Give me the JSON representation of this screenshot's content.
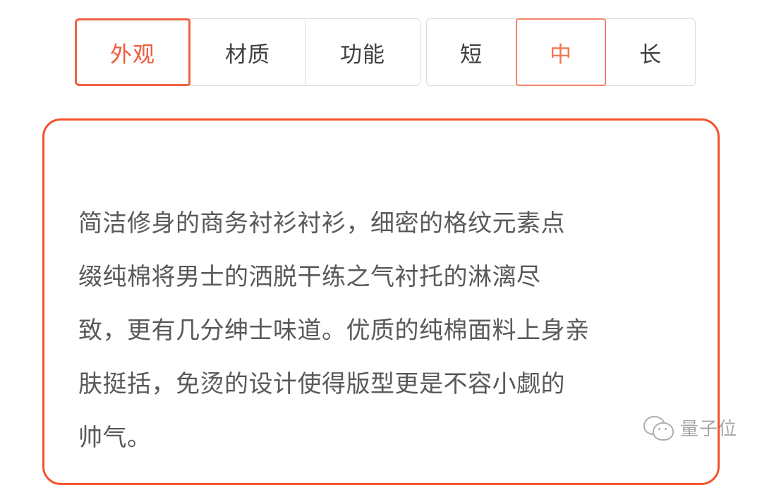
{
  "theme": {
    "background": "#ffffff",
    "accent": "#f4512c",
    "accent_soft": "#f4836b",
    "tab_border": "#dcdcdc",
    "tab_text": "#3f3f3f",
    "body_text": "#59595b"
  },
  "tab_groups": [
    {
      "name": "aspect-group",
      "tabs": [
        {
          "label": "外观",
          "selected": true
        },
        {
          "label": "材质",
          "selected": false
        },
        {
          "label": "功能",
          "selected": false
        }
      ]
    },
    {
      "name": "length-group",
      "tabs": [
        {
          "label": "短",
          "selected": false
        },
        {
          "label": "中",
          "selected": true
        },
        {
          "label": "长",
          "selected": false
        }
      ]
    }
  ],
  "description": {
    "lines": [
      "简洁修身的商务衬衫衬衫，细密的格纹元素点",
      "缀纯棉将男士的洒脱干练之气衬托的淋漓尽",
      "致，更有几分绅士味道。优质的纯棉面料上身亲",
      "肤挺括，免烫的设计使得版型更是不容小觑的",
      "帅气。"
    ],
    "text": "简洁修身的商务衬衫衬衫，细密的格纹元素点\n缀纯棉将男士的洒脱干练之气衬托的淋漓尽\n致，更有几分绅士味道。优质的纯棉面料上身亲\n肤挺括，免烫的设计使得版型更是不容小觑的\n帅气。"
  },
  "watermark": {
    "icon": "wechat-bubbles-icon",
    "text": "量子位"
  }
}
